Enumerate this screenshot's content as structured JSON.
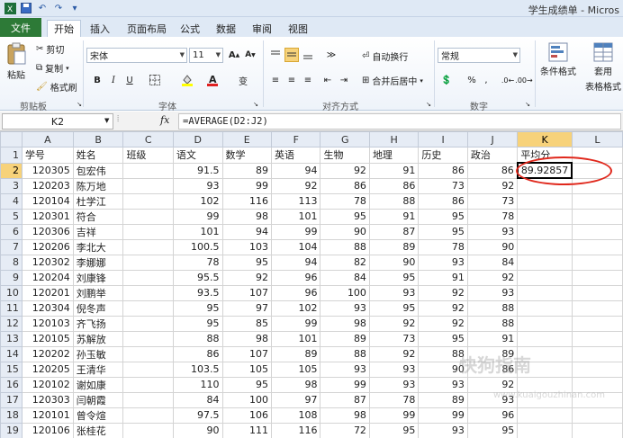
{
  "app": {
    "title": "学生成绩单 - Micros"
  },
  "tabs": [
    "文件",
    "开始",
    "插入",
    "页面布局",
    "公式",
    "数据",
    "审阅",
    "视图"
  ],
  "ribbon": {
    "clipboard": {
      "paste": "粘贴",
      "cut": "剪切",
      "copy": "复制",
      "format_painter": "格式刷",
      "label": "剪贴板"
    },
    "font": {
      "name": "宋体",
      "size": "11",
      "label": "字体",
      "grow": "A",
      "shrink": "A",
      "bold": "B",
      "italic": "I",
      "underline": "U",
      "phonetic": "变"
    },
    "alignment": {
      "wrap": "自动换行",
      "merge": "合并后居中",
      "label": "对齐方式"
    },
    "number": {
      "format": "常规",
      "percent": "%",
      "comma": ",",
      "label": "数字"
    },
    "styles": {
      "conditional": "条件格式",
      "table1": "套用",
      "table2": "表格格式"
    }
  },
  "formula_bar": {
    "name_box": "K2",
    "fx": "fx",
    "formula": "=AVERAGE(D2:J2)"
  },
  "columns": [
    "A",
    "B",
    "C",
    "D",
    "E",
    "F",
    "G",
    "H",
    "I",
    "J",
    "K",
    "L"
  ],
  "header_row": [
    "学号",
    "姓名",
    "班级",
    "语文",
    "数学",
    "英语",
    "生物",
    "地理",
    "历史",
    "政治",
    "平均分",
    ""
  ],
  "rows": [
    [
      "120305",
      "包宏伟",
      "",
      "91.5",
      "89",
      "94",
      "92",
      "91",
      "86",
      "86",
      "89.92857",
      ""
    ],
    [
      "120203",
      "陈万地",
      "",
      "93",
      "99",
      "92",
      "86",
      "86",
      "73",
      "92",
      "",
      ""
    ],
    [
      "120104",
      "杜学江",
      "",
      "102",
      "116",
      "113",
      "78",
      "88",
      "86",
      "73",
      "",
      ""
    ],
    [
      "120301",
      "符合",
      "",
      "99",
      "98",
      "101",
      "95",
      "91",
      "95",
      "78",
      "",
      ""
    ],
    [
      "120306",
      "吉祥",
      "",
      "101",
      "94",
      "99",
      "90",
      "87",
      "95",
      "93",
      "",
      ""
    ],
    [
      "120206",
      "李北大",
      "",
      "100.5",
      "103",
      "104",
      "88",
      "89",
      "78",
      "90",
      "",
      ""
    ],
    [
      "120302",
      "李娜娜",
      "",
      "78",
      "95",
      "94",
      "82",
      "90",
      "93",
      "84",
      "",
      ""
    ],
    [
      "120204",
      "刘康锋",
      "",
      "95.5",
      "92",
      "96",
      "84",
      "95",
      "91",
      "92",
      "",
      ""
    ],
    [
      "120201",
      "刘鹏举",
      "",
      "93.5",
      "107",
      "96",
      "100",
      "93",
      "92",
      "93",
      "",
      ""
    ],
    [
      "120304",
      "倪冬声",
      "",
      "95",
      "97",
      "102",
      "93",
      "95",
      "92",
      "88",
      "",
      ""
    ],
    [
      "120103",
      "齐飞扬",
      "",
      "95",
      "85",
      "99",
      "98",
      "92",
      "92",
      "88",
      "",
      ""
    ],
    [
      "120105",
      "苏解放",
      "",
      "88",
      "98",
      "101",
      "89",
      "73",
      "95",
      "91",
      "",
      ""
    ],
    [
      "120202",
      "孙玉敏",
      "",
      "86",
      "107",
      "89",
      "88",
      "92",
      "88",
      "89",
      "",
      ""
    ],
    [
      "120205",
      "王清华",
      "",
      "103.5",
      "105",
      "105",
      "93",
      "93",
      "90",
      "86",
      "",
      ""
    ],
    [
      "120102",
      "谢如康",
      "",
      "110",
      "95",
      "98",
      "99",
      "93",
      "93",
      "92",
      "",
      ""
    ],
    [
      "120303",
      "闫朝霞",
      "",
      "84",
      "100",
      "97",
      "87",
      "78",
      "89",
      "93",
      "",
      ""
    ],
    [
      "120101",
      "曾令煊",
      "",
      "97.5",
      "106",
      "108",
      "98",
      "99",
      "99",
      "96",
      "",
      ""
    ],
    [
      "120106",
      "张桂花",
      "",
      "90",
      "111",
      "116",
      "72",
      "95",
      "93",
      "95",
      "",
      ""
    ]
  ],
  "watermark": {
    "text": "快狗指南",
    "sub": "www.kuaigouzhinan.com"
  }
}
